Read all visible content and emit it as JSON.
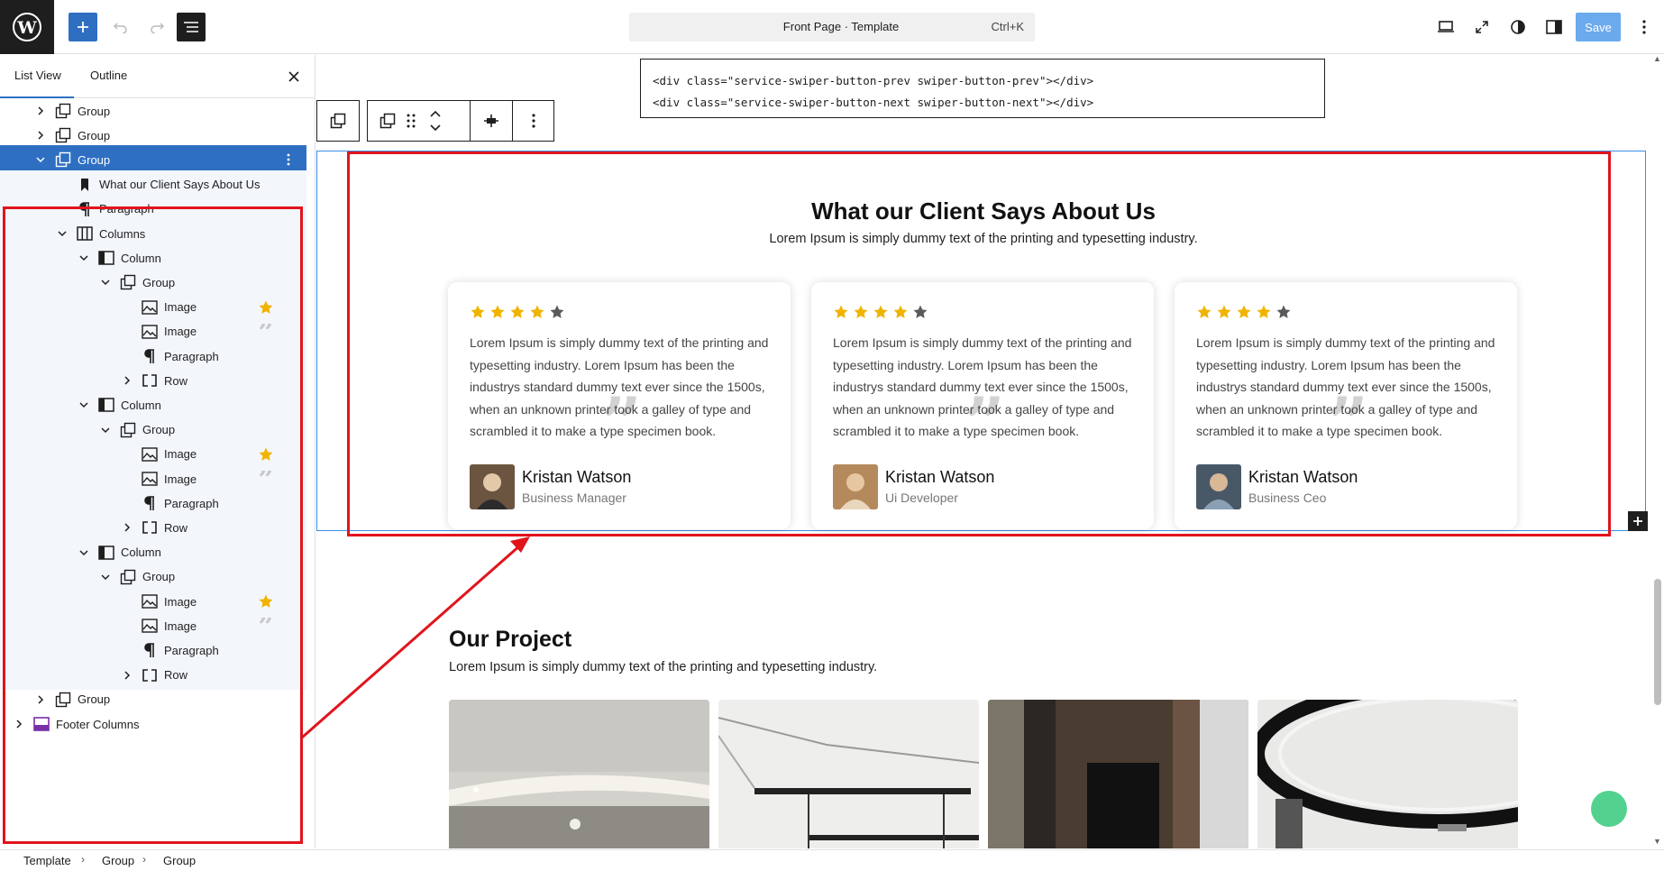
{
  "topbar": {
    "command_title": "Front Page · Template",
    "command_shortcut": "Ctrl+K",
    "save_label": "Save",
    "icons": [
      "wordpress-logo-icon",
      "plus-icon",
      "undo-icon",
      "redo-icon",
      "document-overview-icon",
      "desktop-view-icon",
      "fullscreen-icon",
      "styles-icon",
      "settings-sidebar-icon",
      "more-vertical-icon"
    ]
  },
  "sidebar": {
    "tabs": [
      "List View",
      "Outline"
    ],
    "active_tab": "List View",
    "tree": [
      {
        "label": "Group",
        "icon": "group-icon",
        "chevron": "right"
      },
      {
        "label": "Group",
        "icon": "group-icon",
        "chevron": "right"
      },
      {
        "label": "Group",
        "icon": "group-icon",
        "chevron": "down",
        "selected": true
      },
      {
        "label": "What our Client Says About Us",
        "icon": "bookmark-icon"
      },
      {
        "label": "Paragraph",
        "icon": "paragraph-icon"
      },
      {
        "label": "Columns",
        "icon": "columns-icon",
        "chevron": "down"
      },
      {
        "label": "Column",
        "icon": "column-icon",
        "chevron": "down"
      },
      {
        "label": "Group",
        "icon": "group-icon",
        "chevron": "down"
      },
      {
        "label": "Image",
        "icon": "image-icon",
        "badge": "star"
      },
      {
        "label": "Image",
        "icon": "image-icon",
        "badge": "quote"
      },
      {
        "label": "Paragraph",
        "icon": "paragraph-icon"
      },
      {
        "label": "Row",
        "icon": "row-icon",
        "chevron": "right"
      },
      {
        "label": "Column",
        "icon": "column-icon",
        "chevron": "down"
      },
      {
        "label": "Group",
        "icon": "group-icon",
        "chevron": "down"
      },
      {
        "label": "Image",
        "icon": "image-icon",
        "badge": "star"
      },
      {
        "label": "Image",
        "icon": "image-icon",
        "badge": "quote"
      },
      {
        "label": "Paragraph",
        "icon": "paragraph-icon"
      },
      {
        "label": "Row",
        "icon": "row-icon",
        "chevron": "right"
      },
      {
        "label": "Column",
        "icon": "column-icon",
        "chevron": "down"
      },
      {
        "label": "Group",
        "icon": "group-icon",
        "chevron": "down"
      },
      {
        "label": "Image",
        "icon": "image-icon",
        "badge": "star"
      },
      {
        "label": "Image",
        "icon": "image-icon",
        "badge": "quote"
      },
      {
        "label": "Paragraph",
        "icon": "paragraph-icon"
      },
      {
        "label": "Row",
        "icon": "row-icon",
        "chevron": "right"
      },
      {
        "label": "Group",
        "icon": "group-icon",
        "chevron": "right"
      },
      {
        "label": "Footer Columns",
        "icon": "template-part-icon",
        "chevron": "right"
      }
    ]
  },
  "breadcrumb": [
    "Template",
    "Group",
    "Group"
  ],
  "code_block": [
    "<div class=\"service-swiper-button-prev swiper-button-prev\"></div>",
    "<div class=\"service-swiper-button-next swiper-button-next\"></div>"
  ],
  "testimonials": {
    "title": "What our Client Says About Us",
    "subtitle": "Lorem Ipsum is simply dummy text of the printing and typesetting industry.",
    "cards": [
      {
        "rating": 4,
        "max_rating": 5,
        "text": "Lorem Ipsum is simply dummy text of the printing and typesetting industry. Lorem Ipsum has been the industrys standard dummy text ever since the 1500s, when an unknown printer took a galley of type and scrambled it to make a type specimen book.",
        "name": "Kristan Watson",
        "role": "Business Manager"
      },
      {
        "rating": 4,
        "max_rating": 5,
        "text": "Lorem Ipsum is simply dummy text of the printing and typesetting industry. Lorem Ipsum has been the industrys standard dummy text ever since the 1500s, when an unknown printer took a galley of type and scrambled it to make a type specimen book.",
        "name": "Kristan Watson",
        "role": "Ui Developer"
      },
      {
        "rating": 4,
        "max_rating": 5,
        "text": "Lorem Ipsum is simply dummy text of the printing and typesetting industry. Lorem Ipsum has been the industrys standard dummy text ever since the 1500s, when an unknown printer took a galley of type and scrambled it to make a type specimen book.",
        "name": "Kristan Watson",
        "role": "Business Ceo"
      }
    ]
  },
  "project": {
    "title": "Our Project",
    "subtitle": "Lorem Ipsum is simply dummy text of the printing and typesetting industry."
  },
  "colors": {
    "accent": "#2f6fc2",
    "annotation_red": "#e1141c",
    "star": "#f0b400",
    "star_empty": "#5a5a5a",
    "fab": "#52d28e"
  }
}
